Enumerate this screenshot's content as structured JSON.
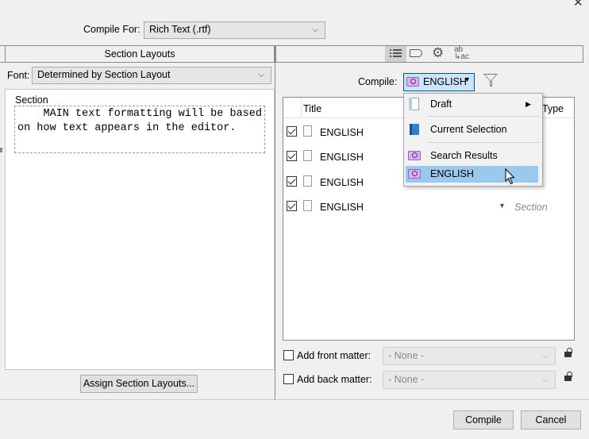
{
  "header": {
    "compile_for_label": "Compile For:",
    "compile_for_value": "Rich Text (.rtf)"
  },
  "left_panel": {
    "tab_title": "Section Layouts",
    "font_label": "Font:",
    "font_value": "Determined by Section Layout",
    "preview_title": "Section",
    "preview_text": "    MAIN text formatting will be based on how text appears in the editor.",
    "assign_button": "Assign Section Layouts..."
  },
  "right_panel": {
    "toolbar_icons": [
      "list-icon",
      "tag-icon",
      "gear-icon",
      "spelling-icon"
    ],
    "compile_label": "Compile:",
    "compile_value": "ENGLISH",
    "columns": {
      "title": "Title",
      "type": "Type"
    },
    "rows": [
      {
        "title": "ENGLISH",
        "checked": true,
        "type": ""
      },
      {
        "title": "ENGLISH",
        "checked": true,
        "type": ""
      },
      {
        "title": "ENGLISH",
        "checked": true,
        "type": ""
      },
      {
        "title": "ENGLISH",
        "checked": true,
        "type": "Section"
      }
    ],
    "front_matter_label": "Add front matter:",
    "front_matter_value": "- None -",
    "back_matter_label": "Add back matter:",
    "back_matter_value": "- None -"
  },
  "dropdown_menu": {
    "items": [
      {
        "label": "Draft",
        "icon": "draft-icon",
        "has_submenu": true
      },
      {
        "label": "Current Selection",
        "icon": "binder-selection-icon"
      },
      {
        "label": "Search Results",
        "icon": "collection-icon"
      },
      {
        "label": "ENGLISH",
        "icon": "collection-icon",
        "highlighted": true
      }
    ]
  },
  "footer": {
    "compile_button": "Compile",
    "cancel_button": "Cancel"
  },
  "colors": {
    "highlight": "#99c9ef",
    "collection_purple": "#d9b4f0",
    "selected_field": "#cce4f7"
  }
}
